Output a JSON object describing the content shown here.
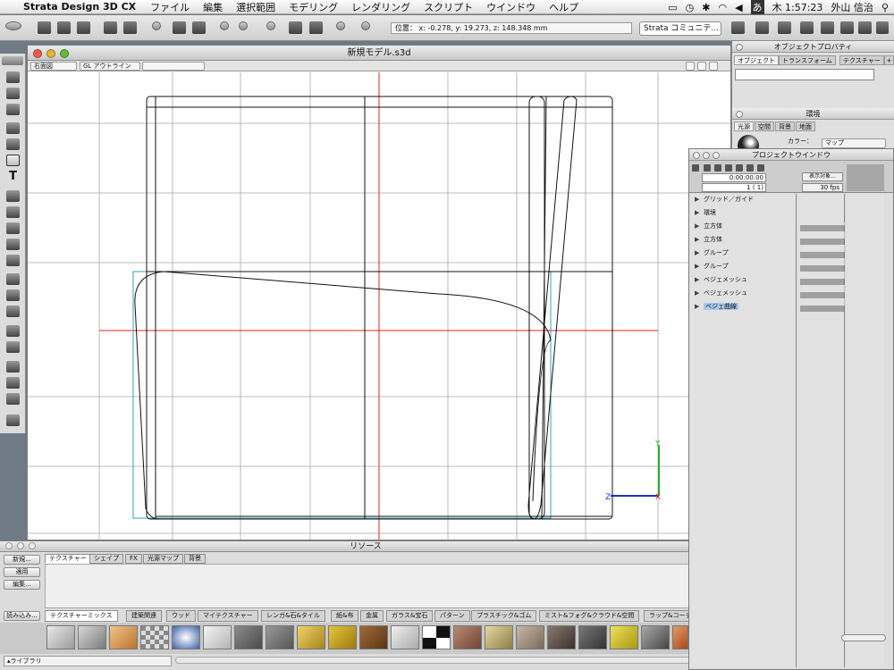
{
  "menubar": {
    "app_name": "Strata Design 3D CX",
    "menus": [
      "ファイル",
      "編集",
      "選択範囲",
      "モデリング",
      "レンダリング",
      "スクリプト",
      "ウインドウ",
      "ヘルプ"
    ],
    "clock": "木 1:57:23",
    "user": "外山 信治",
    "input_method": "あ"
  },
  "toolbar": {
    "coords": "位置： x: -0.278, y: 19.273, z: 148.348 mm",
    "community": "Strata コミュニテ..."
  },
  "view": {
    "title": "新規モデル.s3d",
    "view_select": "右面図",
    "render_select": "GL アウトライン"
  },
  "resource": {
    "title": "リソース",
    "buttons": [
      "新規...",
      "適用",
      "編集...",
      "読み込み..."
    ],
    "tabs": [
      "テクスチャー",
      "シェイプ",
      "FX",
      "光源マップ",
      "背景"
    ],
    "categories": [
      "テクスチャーミックス",
      "建築関連",
      "ウッド",
      "マイテクスチャー",
      "レンガ&石&タイル",
      "紙&布",
      "金属",
      "ガラス&宝石",
      "パターン",
      "プラスチック&ゴム",
      "ミスト&フォグ&クラウド&空間",
      "ラップ&コーティ"
    ],
    "library": "ライブラリ"
  },
  "objprop": {
    "title": "オブジェクトプロパティ",
    "tabs": [
      "オブジェクト",
      "トランスフォーム",
      "テクスチャー"
    ]
  },
  "env": {
    "title": "環境",
    "tabs": [
      "光源",
      "空間",
      "背景",
      "地面"
    ],
    "color_label": "カラー：",
    "map_select": "マップ"
  },
  "project": {
    "title": "プロジェクトウインドウ",
    "timecode": "0:00:00.00",
    "frame": "1 ( 1)",
    "display_btn": "表示対象...",
    "fps": "30 fps",
    "rows": [
      "グリッド／ガイド",
      "環境",
      "立方体",
      "立方体",
      "グループ",
      "グループ",
      "ベジェメッシュ",
      "ベジェメッシュ",
      "ベジェ曲線"
    ],
    "selected_row": "ベジェ曲線"
  },
  "colors": {
    "guide_red": "#e02020",
    "bounds_cyan": "#2ea3bd",
    "axis_green": "#25b025",
    "axis_blue": "#2030c8",
    "selection": "#a9c7f0"
  }
}
